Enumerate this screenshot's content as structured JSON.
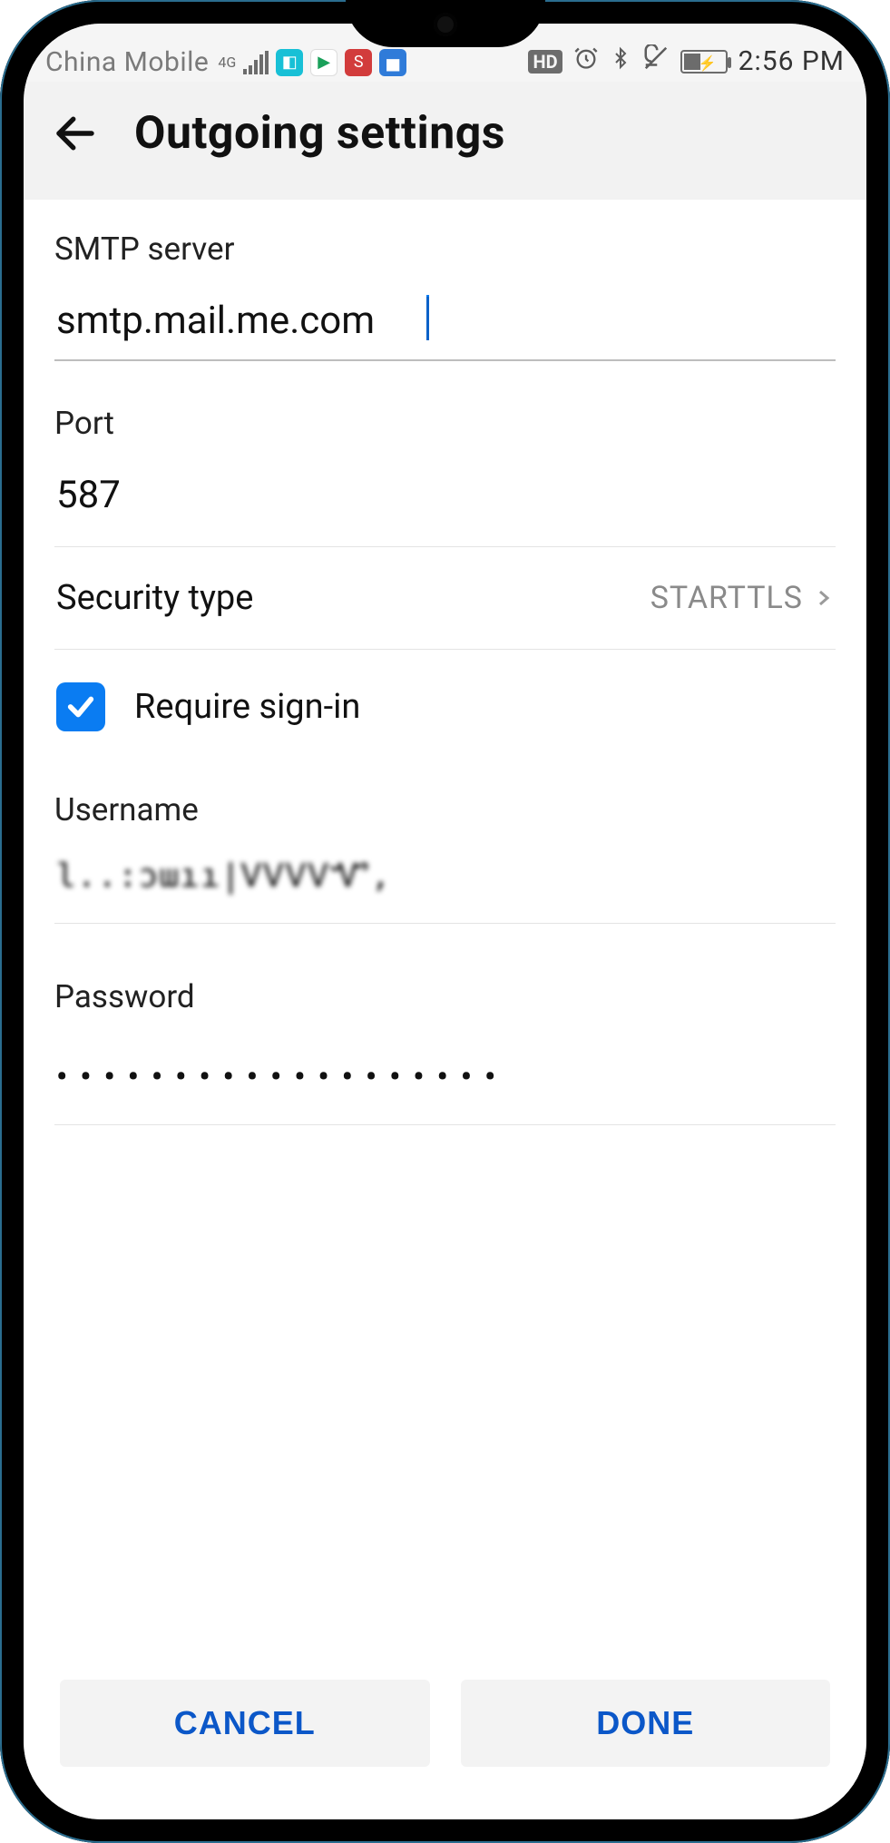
{
  "status": {
    "carrier": "China Mobile",
    "net": "4G",
    "time": "2:56 PM"
  },
  "appbar": {
    "title": "Outgoing settings"
  },
  "form": {
    "smtp_label": "SMTP server",
    "smtp_value": "smtp.mail.me.com",
    "port_label": "Port",
    "port_value": "587",
    "security_label": "Security type",
    "security_value": "STARTTLS",
    "require_signin_label": "Require sign-in",
    "require_signin_checked": true,
    "username_label": "Username",
    "username_value": "l..:ɔɯıı|ᏙᏙᏙᏙᏉ,",
    "password_label": "Password",
    "password_value": "•••••••••••••••••••"
  },
  "buttons": {
    "cancel": "CANCEL",
    "done": "DONE"
  }
}
